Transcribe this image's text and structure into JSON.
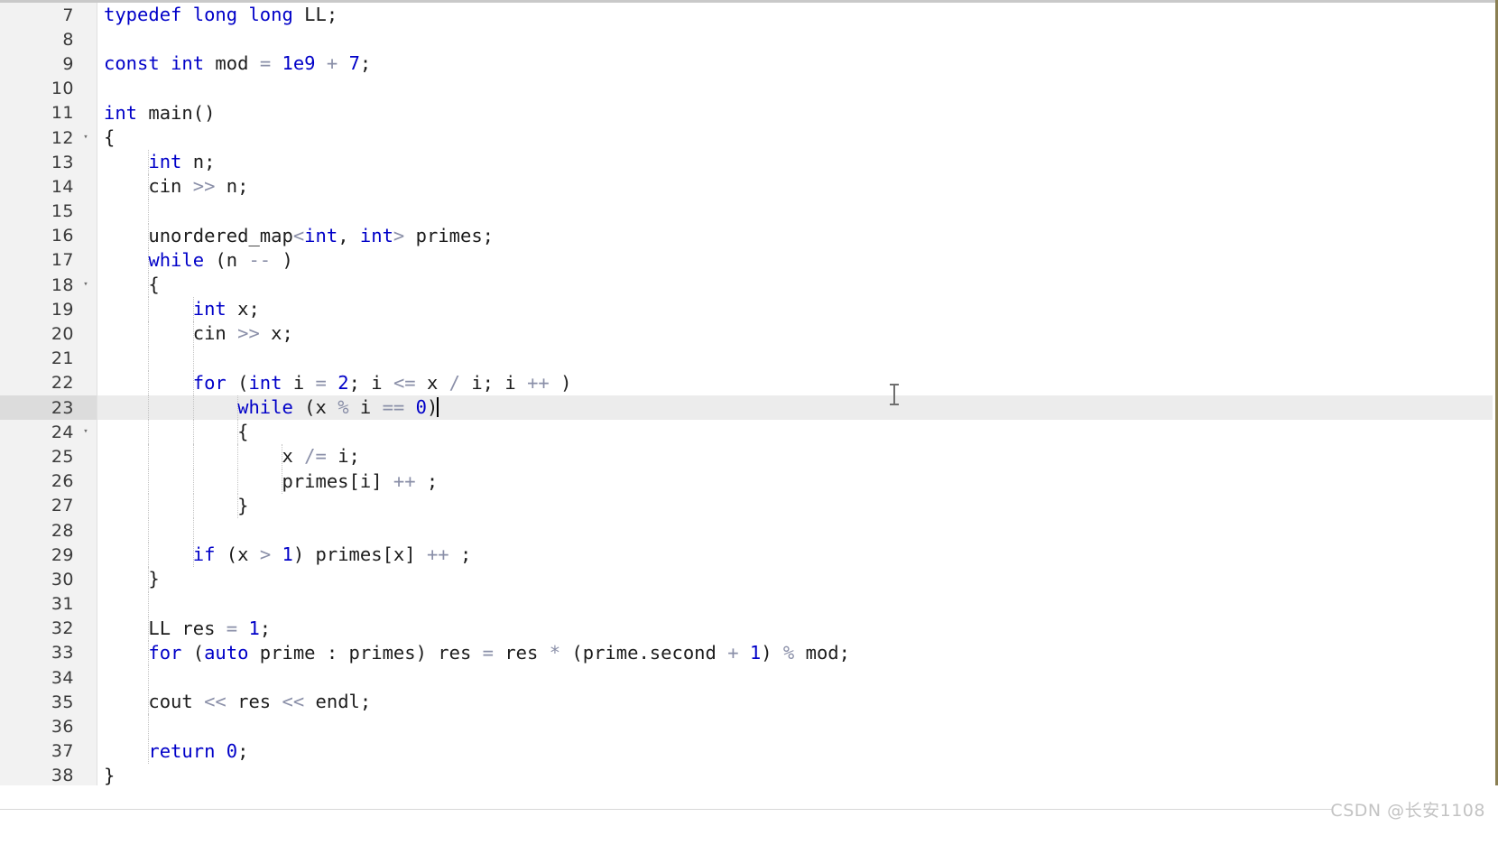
{
  "editor": {
    "language": "cpp",
    "first_visible_line": 7,
    "last_visible_line": 38,
    "active_line": 23,
    "caret_line": 23,
    "colors": {
      "background": "#ffffff",
      "gutter_background": "#f2f2f2",
      "active_line_background": "#ececec",
      "active_gutter_background": "#dcdcdc",
      "keyword": "#0000c8",
      "number": "#0000c8",
      "operator": "#8a8fa8",
      "text": "#1c1c1c",
      "indent_guide": "#c4c4c4",
      "watermark": "#c3c3c3",
      "right_border": "#8a7f52"
    },
    "lines": [
      {
        "number": "7",
        "fold": "",
        "indent": 0,
        "tokens": [
          {
            "t": "typedef",
            "c": "kw"
          },
          {
            "t": " ",
            "c": "plain"
          },
          {
            "t": "long",
            "c": "kw"
          },
          {
            "t": " ",
            "c": "plain"
          },
          {
            "t": "long",
            "c": "kw"
          },
          {
            "t": " LL;",
            "c": "plain"
          }
        ]
      },
      {
        "number": "8",
        "fold": "",
        "indent": 0,
        "tokens": []
      },
      {
        "number": "9",
        "fold": "",
        "indent": 0,
        "tokens": [
          {
            "t": "const",
            "c": "kw"
          },
          {
            "t": " ",
            "c": "plain"
          },
          {
            "t": "int",
            "c": "kw"
          },
          {
            "t": " mod ",
            "c": "plain"
          },
          {
            "t": "=",
            "c": "op"
          },
          {
            "t": " ",
            "c": "plain"
          },
          {
            "t": "1e9",
            "c": "num"
          },
          {
            "t": " ",
            "c": "plain"
          },
          {
            "t": "+",
            "c": "op"
          },
          {
            "t": " ",
            "c": "plain"
          },
          {
            "t": "7",
            "c": "num"
          },
          {
            "t": ";",
            "c": "plain"
          }
        ]
      },
      {
        "number": "10",
        "fold": "",
        "indent": 0,
        "tokens": []
      },
      {
        "number": "11",
        "fold": "",
        "indent": 0,
        "tokens": [
          {
            "t": "int",
            "c": "kw"
          },
          {
            "t": " main()",
            "c": "plain"
          }
        ]
      },
      {
        "number": "12",
        "fold": "▾",
        "indent": 0,
        "tokens": [
          {
            "t": "{",
            "c": "plain"
          }
        ]
      },
      {
        "number": "13",
        "fold": "",
        "indent": 1,
        "tokens": [
          {
            "t": "    ",
            "c": "plain"
          },
          {
            "t": "int",
            "c": "kw"
          },
          {
            "t": " n;",
            "c": "plain"
          }
        ]
      },
      {
        "number": "14",
        "fold": "",
        "indent": 1,
        "tokens": [
          {
            "t": "    cin ",
            "c": "plain"
          },
          {
            "t": ">>",
            "c": "op"
          },
          {
            "t": " n;",
            "c": "plain"
          }
        ]
      },
      {
        "number": "15",
        "fold": "",
        "indent": 1,
        "tokens": []
      },
      {
        "number": "16",
        "fold": "",
        "indent": 1,
        "tokens": [
          {
            "t": "    unordered_map",
            "c": "plain"
          },
          {
            "t": "<",
            "c": "op"
          },
          {
            "t": "int",
            "c": "kw"
          },
          {
            "t": ", ",
            "c": "plain"
          },
          {
            "t": "int",
            "c": "kw"
          },
          {
            "t": ">",
            "c": "op"
          },
          {
            "t": " primes;",
            "c": "plain"
          }
        ]
      },
      {
        "number": "17",
        "fold": "",
        "indent": 1,
        "tokens": [
          {
            "t": "    ",
            "c": "plain"
          },
          {
            "t": "while",
            "c": "kw"
          },
          {
            "t": " (n ",
            "c": "plain"
          },
          {
            "t": "--",
            "c": "op"
          },
          {
            "t": " )",
            "c": "plain"
          }
        ]
      },
      {
        "number": "18",
        "fold": "▾",
        "indent": 1,
        "tokens": [
          {
            "t": "    {",
            "c": "plain"
          }
        ]
      },
      {
        "number": "19",
        "fold": "",
        "indent": 2,
        "tokens": [
          {
            "t": "        ",
            "c": "plain"
          },
          {
            "t": "int",
            "c": "kw"
          },
          {
            "t": " x;",
            "c": "plain"
          }
        ]
      },
      {
        "number": "20",
        "fold": "",
        "indent": 2,
        "tokens": [
          {
            "t": "        cin ",
            "c": "plain"
          },
          {
            "t": ">>",
            "c": "op"
          },
          {
            "t": " x;",
            "c": "plain"
          }
        ]
      },
      {
        "number": "21",
        "fold": "",
        "indent": 2,
        "tokens": []
      },
      {
        "number": "22",
        "fold": "",
        "indent": 2,
        "tokens": [
          {
            "t": "        ",
            "c": "plain"
          },
          {
            "t": "for",
            "c": "kw"
          },
          {
            "t": " (",
            "c": "plain"
          },
          {
            "t": "int",
            "c": "kw"
          },
          {
            "t": " i ",
            "c": "plain"
          },
          {
            "t": "=",
            "c": "op"
          },
          {
            "t": " ",
            "c": "plain"
          },
          {
            "t": "2",
            "c": "num"
          },
          {
            "t": "; i ",
            "c": "plain"
          },
          {
            "t": "<=",
            "c": "op"
          },
          {
            "t": " x ",
            "c": "plain"
          },
          {
            "t": "/",
            "c": "op"
          },
          {
            "t": " i; i ",
            "c": "plain"
          },
          {
            "t": "++",
            "c": "op"
          },
          {
            "t": " )",
            "c": "plain"
          }
        ]
      },
      {
        "number": "23",
        "fold": "",
        "indent": 3,
        "active": true,
        "caret": true,
        "tokens": [
          {
            "t": "            ",
            "c": "plain"
          },
          {
            "t": "while",
            "c": "kw"
          },
          {
            "t": " (x ",
            "c": "plain"
          },
          {
            "t": "%",
            "c": "op"
          },
          {
            "t": " i ",
            "c": "plain"
          },
          {
            "t": "==",
            "c": "op"
          },
          {
            "t": " ",
            "c": "plain"
          },
          {
            "t": "0",
            "c": "num"
          },
          {
            "t": ")",
            "c": "plain"
          }
        ]
      },
      {
        "number": "24",
        "fold": "▾",
        "indent": 3,
        "tokens": [
          {
            "t": "            {",
            "c": "plain"
          }
        ]
      },
      {
        "number": "25",
        "fold": "",
        "indent": 4,
        "tokens": [
          {
            "t": "                x ",
            "c": "plain"
          },
          {
            "t": "/=",
            "c": "op"
          },
          {
            "t": " i;",
            "c": "plain"
          }
        ]
      },
      {
        "number": "26",
        "fold": "",
        "indent": 4,
        "tokens": [
          {
            "t": "                primes[i] ",
            "c": "plain"
          },
          {
            "t": "++",
            "c": "op"
          },
          {
            "t": " ;",
            "c": "plain"
          }
        ]
      },
      {
        "number": "27",
        "fold": "",
        "indent": 3,
        "tokens": [
          {
            "t": "            }",
            "c": "plain"
          }
        ]
      },
      {
        "number": "28",
        "fold": "",
        "indent": 2,
        "tokens": []
      },
      {
        "number": "29",
        "fold": "",
        "indent": 2,
        "tokens": [
          {
            "t": "        ",
            "c": "plain"
          },
          {
            "t": "if",
            "c": "kw"
          },
          {
            "t": " (x ",
            "c": "plain"
          },
          {
            "t": ">",
            "c": "op"
          },
          {
            "t": " ",
            "c": "plain"
          },
          {
            "t": "1",
            "c": "num"
          },
          {
            "t": ") primes[x] ",
            "c": "plain"
          },
          {
            "t": "++",
            "c": "op"
          },
          {
            "t": " ;",
            "c": "plain"
          }
        ]
      },
      {
        "number": "30",
        "fold": "",
        "indent": 1,
        "tokens": [
          {
            "t": "    }",
            "c": "plain"
          }
        ]
      },
      {
        "number": "31",
        "fold": "",
        "indent": 1,
        "tokens": []
      },
      {
        "number": "32",
        "fold": "",
        "indent": 1,
        "tokens": [
          {
            "t": "    LL res ",
            "c": "plain"
          },
          {
            "t": "=",
            "c": "op"
          },
          {
            "t": " ",
            "c": "plain"
          },
          {
            "t": "1",
            "c": "num"
          },
          {
            "t": ";",
            "c": "plain"
          }
        ]
      },
      {
        "number": "33",
        "fold": "",
        "indent": 1,
        "tokens": [
          {
            "t": "    ",
            "c": "plain"
          },
          {
            "t": "for",
            "c": "kw"
          },
          {
            "t": " (",
            "c": "plain"
          },
          {
            "t": "auto",
            "c": "kw"
          },
          {
            "t": " prime : primes) res ",
            "c": "plain"
          },
          {
            "t": "=",
            "c": "op"
          },
          {
            "t": " res ",
            "c": "plain"
          },
          {
            "t": "*",
            "c": "op"
          },
          {
            "t": " (prime.second ",
            "c": "plain"
          },
          {
            "t": "+",
            "c": "op"
          },
          {
            "t": " ",
            "c": "plain"
          },
          {
            "t": "1",
            "c": "num"
          },
          {
            "t": ") ",
            "c": "plain"
          },
          {
            "t": "%",
            "c": "op"
          },
          {
            "t": " mod;",
            "c": "plain"
          }
        ]
      },
      {
        "number": "34",
        "fold": "",
        "indent": 1,
        "tokens": []
      },
      {
        "number": "35",
        "fold": "",
        "indent": 1,
        "tokens": [
          {
            "t": "    cout ",
            "c": "plain"
          },
          {
            "t": "<<",
            "c": "op"
          },
          {
            "t": " res ",
            "c": "plain"
          },
          {
            "t": "<<",
            "c": "op"
          },
          {
            "t": " endl;",
            "c": "plain"
          }
        ]
      },
      {
        "number": "36",
        "fold": "",
        "indent": 1,
        "tokens": []
      },
      {
        "number": "37",
        "fold": "",
        "indent": 1,
        "tokens": [
          {
            "t": "    ",
            "c": "plain"
          },
          {
            "t": "return",
            "c": "kw"
          },
          {
            "t": " ",
            "c": "plain"
          },
          {
            "t": "0",
            "c": "num"
          },
          {
            "t": ";",
            "c": "plain"
          }
        ]
      },
      {
        "number": "38",
        "fold": "",
        "indent": 0,
        "tokens": [
          {
            "t": "}",
            "c": "plain"
          }
        ]
      }
    ]
  },
  "footer": {
    "watermark": "CSDN @长安1108"
  }
}
